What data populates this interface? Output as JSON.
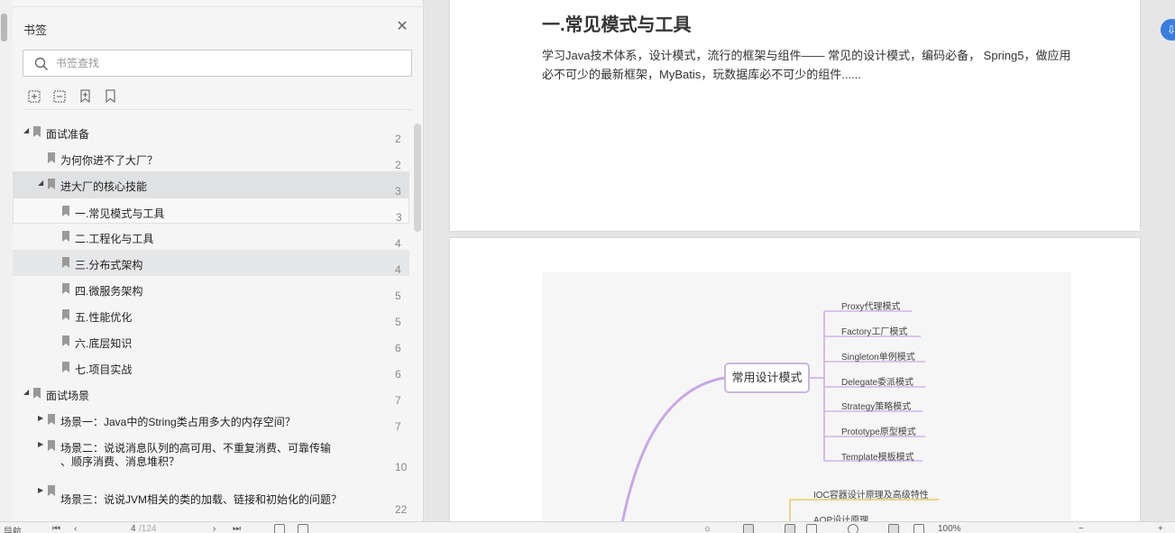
{
  "bookmark_panel": {
    "title": "书签",
    "search_placeholder": "书签查找",
    "items": [
      {
        "label": "面试准备",
        "page": "2"
      },
      {
        "label": "为何你进不了大厂？",
        "page": "2"
      },
      {
        "label": "进大厂的核心技能",
        "page": "3"
      },
      {
        "label": "一.常见模式与工具",
        "page": "3"
      },
      {
        "label": "二.工程化与工具",
        "page": "4"
      },
      {
        "label": "三.分布式架构",
        "page": "4"
      },
      {
        "label": "四.微服务架构",
        "page": "5"
      },
      {
        "label": "五.性能优化",
        "page": "5"
      },
      {
        "label": "六.底层知识",
        "page": "6"
      },
      {
        "label": "七.项目实战",
        "page": "6"
      },
      {
        "label": "面试场景",
        "page": "7"
      },
      {
        "label": "场景一：Java中的String类占用多大的内存空间？",
        "page": "7"
      },
      {
        "label": "场景二：说说消息队列的高可用、不重复消费、可靠传输",
        "label2": "、顺序消费、消息堆积？",
        "page": "10"
      },
      {
        "label": "场景三：说说JVM相关的类的加载、链接和初始化的问题？",
        "page": "22"
      }
    ]
  },
  "document": {
    "heading": "一.常见模式与工具",
    "paragraph_line1": "学习Java技术体系，设计模式，流行的框架与组件—— 常见的设计模式，编码必备， Spring5，做应用",
    "paragraph_line2": "必不可少的最新框架，MyBatis，玩数据库必不可少的组件......",
    "mindmap": {
      "center": "常用设计模式",
      "leaves": [
        "Proxy代理模式",
        "Factory工厂模式",
        "Singleton单例模式",
        "Delegate委派模式",
        "Strategy策略模式",
        "Prototype原型模式",
        "Template模板模式"
      ],
      "leaves2": [
        "IOC容器设计原理及高级特性",
        "AOP设计原理"
      ],
      "colors": {
        "purple": "#c9a8e6",
        "yellow": "#e8c66a"
      }
    }
  },
  "status_bar": {
    "nav_label": "导航",
    "page_indicator": "4",
    "page_total": "/124",
    "zoom": "100%"
  },
  "icons": [
    "close-icon",
    "search-icon",
    "expand-all-icon",
    "collapse-all-icon",
    "add-bookmark-icon",
    "bookmark-icon"
  ]
}
